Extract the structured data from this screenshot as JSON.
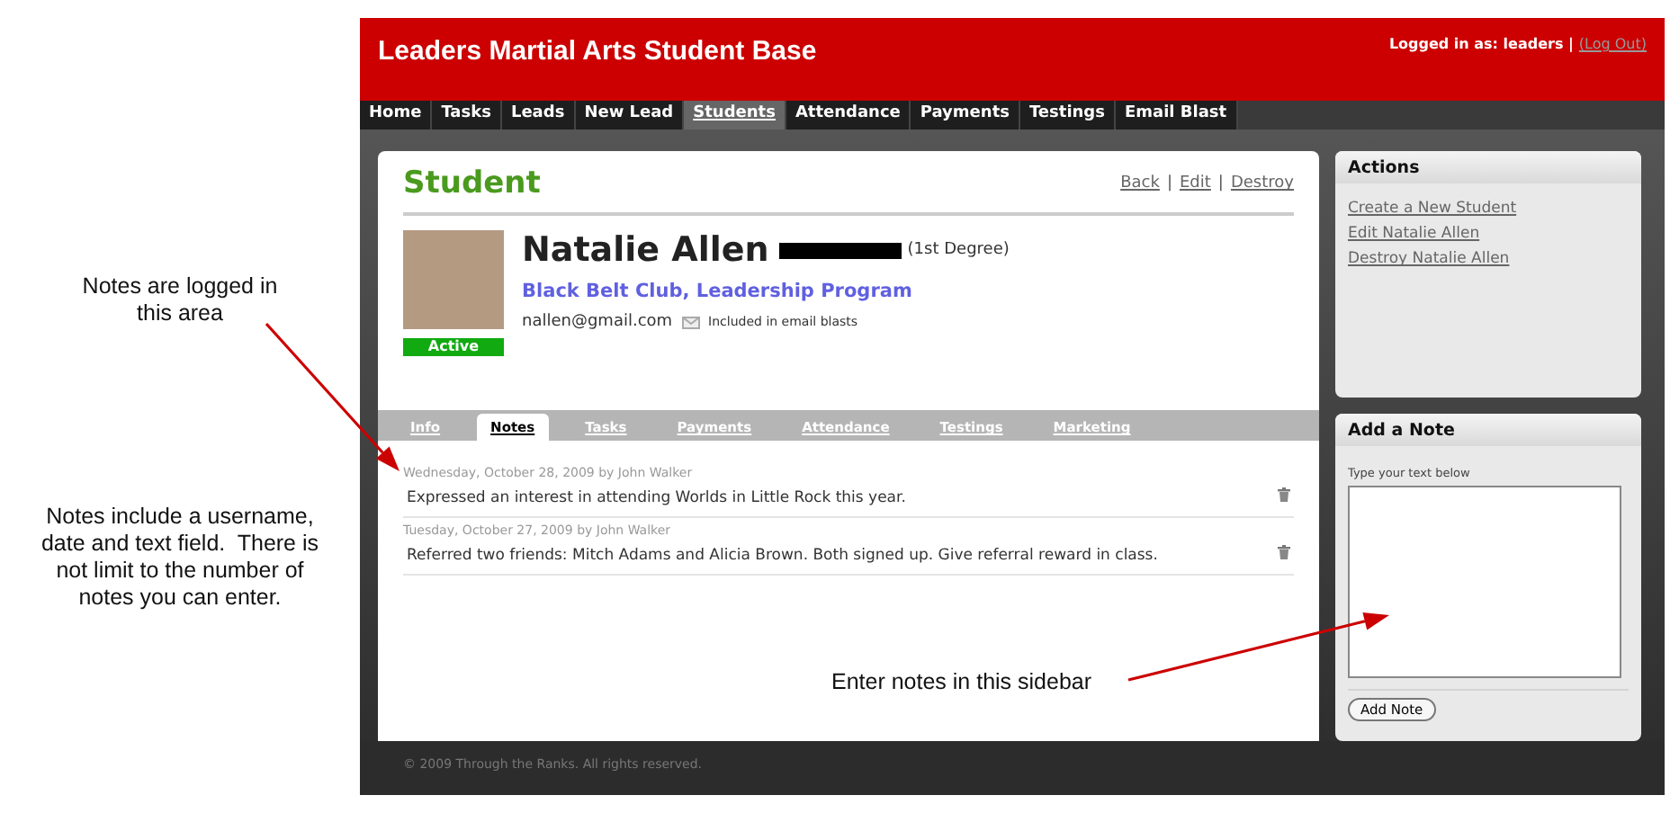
{
  "app": {
    "title": "Leaders Martial Arts Student Base",
    "login_label": "Logged in as: leaders |",
    "logout": "(Log Out)"
  },
  "nav": [
    {
      "label": "Home",
      "selected": false
    },
    {
      "label": "Tasks",
      "selected": false
    },
    {
      "label": "Leads",
      "selected": false
    },
    {
      "label": "New Lead",
      "selected": false
    },
    {
      "label": "Students",
      "selected": true
    },
    {
      "label": "Attendance",
      "selected": false
    },
    {
      "label": "Payments",
      "selected": false
    },
    {
      "label": "Testings",
      "selected": false
    },
    {
      "label": "Email Blast",
      "selected": false
    }
  ],
  "student": {
    "heading": "Student",
    "links": [
      "Back",
      "Edit",
      "Destroy"
    ],
    "separator": "|",
    "name": "Natalie Allen",
    "rank": "(1st Degree)",
    "programs": "Black Belt Club, Leadership Program",
    "email": "nallen@gmail.com",
    "email_note": "Included in email blasts",
    "status": "Active"
  },
  "tabs": [
    {
      "label": "Info",
      "selected": false
    },
    {
      "label": "Notes",
      "selected": true
    },
    {
      "label": "Tasks",
      "selected": false
    },
    {
      "label": "Payments",
      "selected": false
    },
    {
      "label": "Attendance",
      "selected": false
    },
    {
      "label": "Testings",
      "selected": false
    },
    {
      "label": "Marketing",
      "selected": false
    }
  ],
  "notes": [
    {
      "meta": "Wednesday, October 28, 2009 by John Walker",
      "text": "Expressed an interest in attending Worlds in Little Rock this year."
    },
    {
      "meta": "Tuesday, October 27, 2009 by John Walker",
      "text": "Referred two friends: Mitch Adams and Alicia Brown. Both signed up. Give referral reward in class."
    }
  ],
  "sidebar": {
    "actions": {
      "title": "Actions",
      "links": [
        "Create a New Student",
        "Edit Natalie Allen",
        "Destroy Natalie Allen"
      ]
    },
    "add_note": {
      "title": "Add a Note",
      "label": "Type your text below",
      "button": "Add Note"
    }
  },
  "footer": "© 2009 Through the Ranks. All rights reserved.",
  "annotations": [
    "Notes are logged in this area",
    "Notes include a username, date and text field.  There is not limit to the number of notes you can enter.",
    "Enter notes in this sidebar"
  ]
}
